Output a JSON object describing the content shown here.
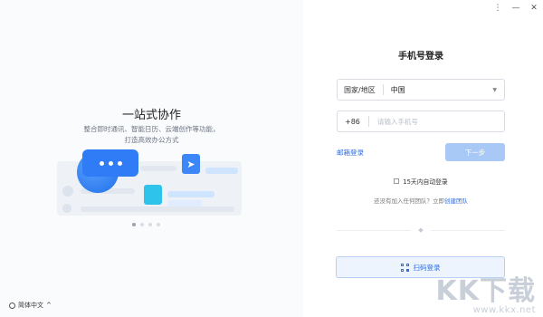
{
  "window": {
    "controls": [
      {
        "name": "menu-icon",
        "glyph": "⋮"
      },
      {
        "name": "minimize-icon",
        "glyph": "—"
      },
      {
        "name": "close-icon",
        "glyph": "✕"
      }
    ]
  },
  "left": {
    "title": "一站式协作",
    "subtitle_line1": "整合即时通讯、智能日历、云端创作等功能，",
    "subtitle_line2": "打造高效办公方式",
    "carousel_count": 4,
    "carousel_active": 0,
    "language": "简体中文",
    "language_caret": "^"
  },
  "login": {
    "title": "手机号登录",
    "country_label": "国家/地区",
    "country_value": "中国",
    "country_caret": "▼",
    "phone_code": "+86",
    "phone_placeholder": "请输入手机号",
    "phone_value": "",
    "email_login": "邮箱登录",
    "next_button": "下一步",
    "auto_login_label": "15天内自动登录",
    "auto_login_checked": false,
    "invite_text": "还没有加入任何团队？立即",
    "invite_link": "创建团队",
    "qr_button": "扫码登录"
  },
  "watermark": {
    "logo": "KK下载",
    "url": "www.kkx.net"
  },
  "colors": {
    "accent": "#2f6ee0",
    "next_disabled": "#a8c8f5",
    "qr_bg": "#eef4fe"
  }
}
